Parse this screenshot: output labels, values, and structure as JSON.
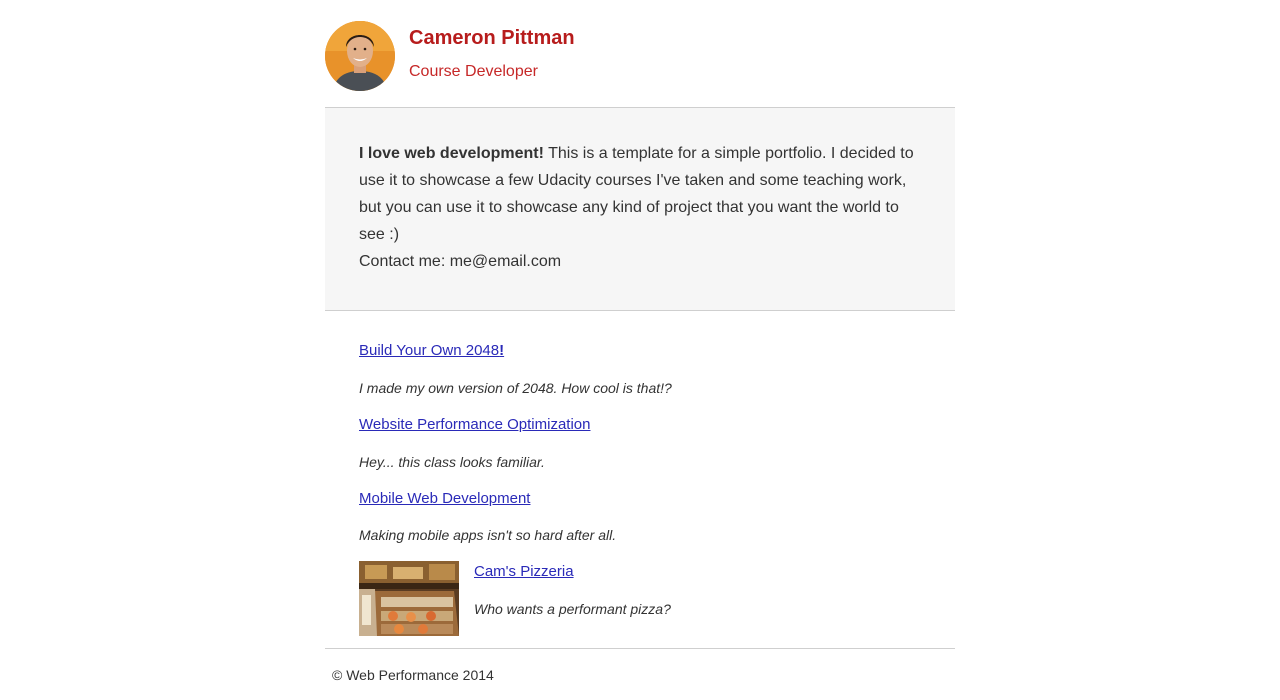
{
  "header": {
    "name": "Cameron Pittman",
    "role": "Course Developer"
  },
  "about": {
    "intro_bold": "I love web development!",
    "intro_text": " This is a template for a simple portfolio. I decided to use it to showcase a few Udacity courses I've taken and some teaching work, but you can use it to showcase any kind of project that you want the world to see :)",
    "contact": "Contact me: me@email.com"
  },
  "projects": [
    {
      "title": "Build Your Own 2048",
      "title_suffix": "!",
      "description": "I made my own version of 2048. How cool is that!?"
    },
    {
      "title": "Website Performance Optimization",
      "description": "Hey... this class looks familiar."
    },
    {
      "title": "Mobile Web Development",
      "description": "Making mobile apps isn't so hard after all."
    },
    {
      "title": "Cam's Pizzeria",
      "description": "Who wants a performant pizza?"
    }
  ],
  "footer": {
    "copyright": "© Web Performance 2014"
  },
  "colors": {
    "accent": "#b71c1c",
    "link": "#2a2ab8",
    "panel": "#f6f6f6"
  }
}
